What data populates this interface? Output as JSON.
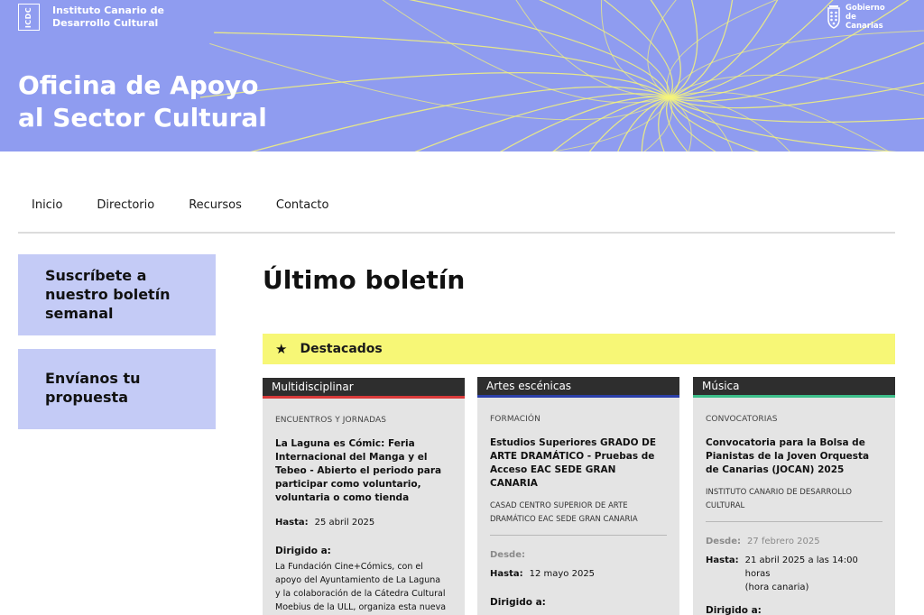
{
  "header": {
    "icdc_mark": "ICDC",
    "icdc_line1": "Instituto Canario de",
    "icdc_line2": "Desarrollo Cultural",
    "gob_line1": "Gobierno",
    "gob_line2": "de Canarias",
    "title_line1": "Oficina de Apoyo",
    "title_line2": "al Sector Cultural",
    "hero_color": "#8f9cf0",
    "line_color": "#f5f37a"
  },
  "nav": {
    "items": [
      "Inicio",
      "Directorio",
      "Recursos",
      "Contacto"
    ]
  },
  "sidebar": {
    "subscribe_line1": "Suscríbete a",
    "subscribe_line2": "nuestro boletín",
    "subscribe_line3": "semanal",
    "propose_line1": "Envíanos tu",
    "propose_line2": "propuesta"
  },
  "main": {
    "title": "Último boletín",
    "featured_icon": "star-icon",
    "featured_label": "Destacados"
  },
  "cards": [
    {
      "tab": "Multidisciplinar",
      "accent": "#d93a3a",
      "category": "ENCUENTROS Y JORNADAS",
      "title_lines": [
        "La Laguna es Cómic: Feria",
        "Internacional del Manga y el",
        "Tebeo - Abierto el periodo para",
        "participar como voluntario,",
        "voluntaria o como tienda"
      ],
      "hasta_label": "Hasta:",
      "hasta_value": "25 abril 2025",
      "dirigido_label": "Dirigido a:",
      "desc_lines": [
        "La Fundación Cine+Cómics, con el",
        "apoyo del Ayuntamiento de La Laguna",
        "y la colaboración de la Cátedra Cultural",
        "Moebius de la ULL, organiza esta nueva"
      ]
    },
    {
      "tab": "Artes escénicas",
      "accent": "#2b3fa8",
      "category": "FORMACIÓN",
      "title_lines": [
        "Estudios Superiores GRADO DE",
        "ARTE DRAMÁTICO - Pruebas de",
        "Acceso EAC SEDE GRAN",
        "CANARIA"
      ],
      "org_lines": [
        "CASAD CENTRO SUPERIOR DE ARTE",
        "DRAMÁTICO EAC SEDE GRAN CANARIA"
      ],
      "desde_label": "Desde:",
      "hasta_label": "Hasta:",
      "hasta_value": "12 mayo 2025",
      "dirigido_label": "Dirigido a:"
    },
    {
      "tab": "Música",
      "accent": "#3dbf8a",
      "category": "CONVOCATORIAS",
      "title_lines": [
        "Convocatoria para la Bolsa de",
        "Pianistas de la Joven Orquesta",
        "de Canarias (JOCAN) 2025"
      ],
      "org_lines": [
        "INSTITUTO CANARIO DE DESARROLLO",
        "CULTURAL"
      ],
      "desde_label": "Desde:",
      "desde_value": "27 febrero 2025",
      "hasta_label": "Hasta:",
      "hasta_value_line1": "21 abril 2025 a las 14:00 horas",
      "hasta_value_line2": "(hora canaria)",
      "dirigido_label": "Dirigido a:"
    }
  ]
}
